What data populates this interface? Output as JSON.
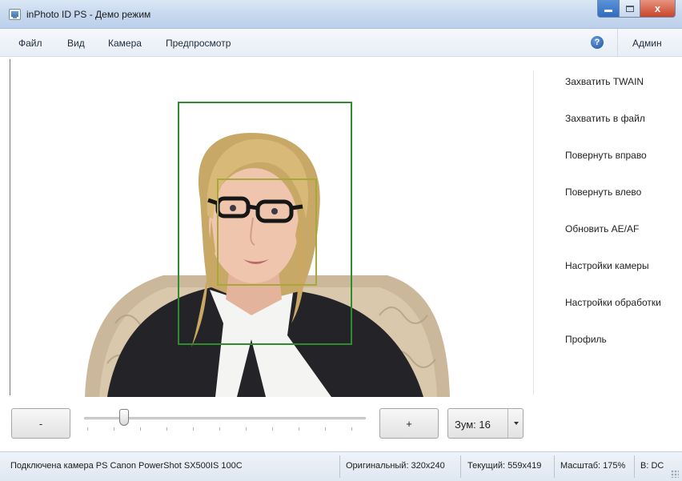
{
  "window": {
    "title": "inPhoto ID PS - Демо режим",
    "close_glyph": "x"
  },
  "menu": {
    "items": [
      "Файл",
      "Вид",
      "Камера",
      "Предпросмотр"
    ],
    "help_glyph": "?",
    "user": "Админ"
  },
  "actions": [
    "Захватить TWAIN",
    "Захватить в файл",
    "Повернуть вправо",
    "Повернуть влево",
    "Обновить AE/AF",
    "Настройки камеры",
    "Настройки обработки",
    "Профиль"
  ],
  "controls": {
    "minus_label": "-",
    "plus_label": "+",
    "zoom_label": "Зум: 16",
    "zoom_slider_fraction": 0.13
  },
  "status": {
    "camera": "Подключена камера PS Canon PowerShot SX500IS 100C",
    "original": "Оригинальный: 320x240",
    "current": "Текущий: 559x419",
    "scale": "Масштаб: 175%",
    "b": "B: DC"
  },
  "colors": {
    "outer_frame": "#2e8b2e",
    "inner_frame": "#a8a83a"
  },
  "icons": {
    "app": "app-icon",
    "help": "help-icon",
    "minimize": "minimize-icon",
    "maximize": "maximize-icon",
    "close": "close-icon",
    "dropdown": "chevron-down-icon"
  }
}
